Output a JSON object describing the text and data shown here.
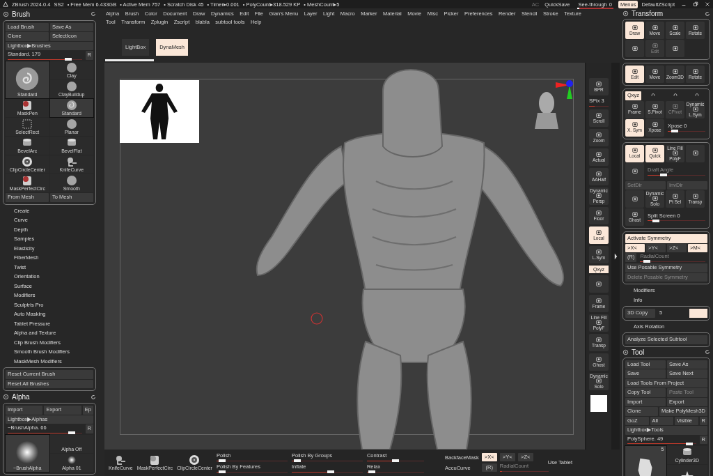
{
  "title_bar": {
    "app": "ZBrush 2024.0.4",
    "stats": [
      "SS2",
      "• Free Mem 6.433GB",
      "• Active Mem 757",
      "• Scratch Disk 45",
      "• Timer▸0.001",
      "• PolyCount▸318.529 KP",
      "• MeshCount▸5"
    ],
    "ac": "AC",
    "quicksave": "QuickSave",
    "see_through": {
      "label": "See-through",
      "value": "0",
      "level": 0
    },
    "menus": {
      "label": "Menus",
      "selected": true
    },
    "script": "DefaultZScript"
  },
  "menu_bar": [
    "Alpha",
    "Brush",
    "Color",
    "Document",
    "Draw",
    "Dynamics",
    "Edit",
    "File",
    "Gian's Menu",
    "Layer",
    "Light",
    "Macro",
    "Marker",
    "Material",
    "Movie",
    "Misc",
    "Picker",
    "Preferences",
    "Render",
    "Stencil",
    "Stroke",
    "Texture",
    "Tool",
    "Transform",
    "Zplugin",
    "Zscript",
    "blabla",
    "subtool tools",
    "Help"
  ],
  "doc_tabs": [
    {
      "label": "LightBox",
      "selected": false
    },
    {
      "label": "DynaMesh",
      "selected": true
    }
  ],
  "left_panel": [
    {
      "title": "Brush",
      "sections": [
        {
          "kind": "box",
          "parts": [
            {
              "kind": "row",
              "controls": [
                {
                  "kind": "button",
                  "label": "Load Brush"
                },
                {
                  "kind": "button",
                  "label": "Save As"
                }
              ]
            },
            {
              "kind": "row",
              "controls": [
                {
                  "kind": "button",
                  "label": "Clone"
                },
                {
                  "kind": "button",
                  "label": "SelectIcon"
                }
              ]
            },
            {
              "kind": "row",
              "controls": [
                {
                  "kind": "button",
                  "label": "Lightbox▶Brushes"
                }
              ]
            },
            {
              "kind": "row",
              "controls": [
                {
                  "kind": "slider",
                  "label": "Standard. 179",
                  "level": 0.85
                },
                {
                  "kind": "small",
                  "label": "R"
                }
              ]
            },
            {
              "kind": "tiles",
              "current": {
                "name": "Standard",
                "kind": "swirl"
              },
              "items": [
                {
                  "name": "Clay",
                  "kind": "sphere",
                  "selected": false
                },
                {
                  "name": "ClayBuildup",
                  "kind": "sphere",
                  "selected": false
                },
                {
                  "name": "MaskPen",
                  "kind": "mask",
                  "selected": false
                },
                {
                  "name": "Standard",
                  "kind": "swirl",
                  "selected": true
                },
                {
                  "name": "SelectRect",
                  "kind": "rect",
                  "selected": false
                },
                {
                  "name": "Planar",
                  "kind": "sphere",
                  "selected": false
                },
                {
                  "name": "BevelArc",
                  "kind": "cylinder",
                  "selected": false
                },
                {
                  "name": "BevelFlat",
                  "kind": "cylinder",
                  "selected": false
                },
                {
                  "name": "ClipCircleCenter",
                  "kind": "clip",
                  "selected": false
                },
                {
                  "name": "KnifeCurve",
                  "kind": "knife",
                  "selected": false
                },
                {
                  "name": "MaskPerfectCirc",
                  "kind": "mask",
                  "selected": false
                },
                {
                  "name": "Smooth",
                  "kind": "sphere",
                  "selected": false
                }
              ]
            },
            {
              "kind": "row",
              "controls": [
                {
                  "kind": "button",
                  "label": "From Mesh"
                },
                {
                  "kind": "button",
                  "label": "To Mesh"
                }
              ]
            }
          ]
        },
        {
          "kind": "item",
          "label": "Create"
        },
        {
          "kind": "item",
          "label": "Curve"
        },
        {
          "kind": "item",
          "label": "Depth"
        },
        {
          "kind": "item",
          "label": "Samples"
        },
        {
          "kind": "item",
          "label": "Elasticity"
        },
        {
          "kind": "item",
          "label": "FiberMesh"
        },
        {
          "kind": "item",
          "label": "Twist"
        },
        {
          "kind": "item",
          "label": "Orientation"
        },
        {
          "kind": "item",
          "label": "Surface"
        },
        {
          "kind": "item",
          "label": "Modifiers"
        },
        {
          "kind": "item",
          "label": "Sculptris Pro"
        },
        {
          "kind": "item",
          "label": "Auto Masking"
        },
        {
          "kind": "item",
          "label": "Tablet Pressure"
        },
        {
          "kind": "item",
          "label": "Alpha and Texture"
        },
        {
          "kind": "item",
          "label": "Clip Brush Modifiers"
        },
        {
          "kind": "item",
          "label": "Smooth Brush Modifiers"
        },
        {
          "kind": "item",
          "label": "MaskMesh Modifiers"
        },
        {
          "kind": "box",
          "parts": [
            {
              "kind": "row",
              "controls": [
                {
                  "kind": "button",
                  "label": "Reset Current Brush"
                }
              ]
            },
            {
              "kind": "row",
              "controls": [
                {
                  "kind": "button",
                  "label": "Reset All Brushes"
                }
              ]
            }
          ]
        }
      ]
    },
    {
      "title": "Alpha",
      "sections": [
        {
          "kind": "box",
          "parts": [
            {
              "kind": "row",
              "controls": [
                {
                  "kind": "button",
                  "label": "Import"
                },
                {
                  "kind": "button",
                  "label": "Export"
                },
                {
                  "kind": "small",
                  "label": "Ep"
                }
              ]
            },
            {
              "kind": "row",
              "controls": [
                {
                  "kind": "button",
                  "label": "Lightbox▶Alphas"
                }
              ]
            },
            {
              "kind": "row",
              "controls": [
                {
                  "kind": "slider",
                  "label": "~BrushAlpha. 66",
                  "level": 0.9
                },
                {
                  "kind": "small",
                  "label": "R"
                }
              ]
            },
            {
              "kind": "tiles",
              "current": {
                "name": "~BrushAlpha",
                "kind": "glow"
              },
              "items": [
                {
                  "name": "Alpha Off",
                  "kind": "none",
                  "selected": false
                },
                {
                  "name": "Alpha 01",
                  "kind": "glow",
                  "selected": false
                }
              ]
            }
          ]
        }
      ]
    }
  ],
  "right_panel": [
    {
      "title": "Transform",
      "sections": [
        {
          "kind": "box",
          "parts": [
            {
              "kind": "row",
              "controls": [
                {
                  "kind": "icon",
                  "label": "Draw",
                  "on": true
                },
                {
                  "kind": "icon",
                  "label": "Move",
                  "on": false
                },
                {
                  "kind": "icon",
                  "label": "Scale",
                  "on": false
                },
                {
                  "kind": "icon",
                  "label": "Rotate",
                  "on": false
                }
              ]
            },
            {
              "kind": "row",
              "controls": [
                {
                  "kind": "icon",
                  "disabled": false
                },
                {
                  "kind": "icon",
                  "label": "Edit",
                  "disabled": true
                },
                {
                  "kind": "icon",
                  "disabled": false
                }
              ]
            }
          ]
        },
        {
          "kind": "box",
          "parts": [
            {
              "kind": "row",
              "controls": [
                {
                  "kind": "icon",
                  "label": "Edit",
                  "on": true
                },
                {
                  "kind": "icon",
                  "label": "Move",
                  "on": false
                },
                {
                  "kind": "icon",
                  "label": "Zoom3D",
                  "on": false
                },
                {
                  "kind": "icon",
                  "label": "Rotate",
                  "on": false
                }
              ]
            }
          ]
        },
        {
          "kind": "box",
          "parts": [
            {
              "kind": "row",
              "controls": [
                {
                  "kind": "small",
                  "label": "Qxyz",
                  "on": true
                },
                {
                  "kind": "mini",
                  "on": false
                },
                {
                  "kind": "mini",
                  "on": false
                },
                {
                  "kind": "mini",
                  "on": false
                }
              ]
            },
            {
              "kind": "row",
              "controls": [
                {
                  "kind": "icon",
                  "label": "Frame",
                  "disabled": false
                },
                {
                  "kind": "icon",
                  "label": "S.Pivot",
                  "disabled": false
                },
                {
                  "kind": "icon",
                  "label": "CPivot",
                  "disabled": true
                },
                {
                  "kind": "icon",
                  "label": "L.Sym",
                  "caption": "Dynamic",
                  "disabled": false
                }
              ]
            },
            {
              "kind": "row",
              "controls": [
                {
                  "kind": "icon",
                  "label": "X. Sym",
                  "on": true
                },
                {
                  "kind": "icon",
                  "label": "Xpose",
                  "on": false
                },
                {
                  "kind": "slider",
                  "label": "Xpose 0",
                  "level": 0.12
                }
              ]
            }
          ]
        },
        {
          "kind": "box",
          "parts": [
            {
              "kind": "row",
              "controls": [
                {
                  "kind": "icon",
                  "label": "Local",
                  "on": true
                },
                {
                  "kind": "icon",
                  "label": "Quick",
                  "on": true
                },
                {
                  "kind": "icon",
                  "label": "PolyF",
                  "caption": "Line Fill",
                  "on": false
                },
                {
                  "kind": "icon",
                  "on": false
                }
              ]
            },
            {
              "kind": "row",
              "controls": [
                {
                  "kind": "icon",
                  "disabled": false
                },
                {
                  "kind": "slider",
                  "label": "Draft Angle",
                  "level": 0.25,
                  "disabled": true
                }
              ]
            },
            {
              "kind": "row",
              "controls": [
                {
                  "kind": "button",
                  "label": "SetDir",
                  "disabled": true
                },
                {
                  "kind": "button",
                  "label": "InvDir",
                  "disabled": true
                }
              ]
            },
            {
              "kind": "row",
              "controls": [
                {
                  "kind": "icon"
                },
                {
                  "kind": "icon",
                  "label": "Solo",
                  "caption": "Dynamic"
                },
                {
                  "kind": "icon",
                  "label": "Pt Sel"
                },
                {
                  "kind": "icon",
                  "label": "Transp"
                }
              ]
            },
            {
              "kind": "row",
              "controls": [
                {
                  "kind": "icon",
                  "label": "Ghost"
                },
                {
                  "kind": "slider",
                  "label": "Split Screen 0",
                  "level": 0.1
                }
              ]
            }
          ]
        },
        {
          "kind": "box",
          "parts": [
            {
              "kind": "row",
              "controls": [
                {
                  "kind": "button",
                  "label": "Activate Symmetry",
                  "on": true
                }
              ]
            },
            {
              "kind": "row",
              "controls": [
                {
                  "kind": "button",
                  "label": ">X<",
                  "on": true
                },
                {
                  "kind": "button",
                  "label": ">Y<",
                  "on": false
                },
                {
                  "kind": "button",
                  "label": ">Z<",
                  "on": false
                },
                {
                  "kind": "button",
                  "label": ">M<",
                  "on": true
                }
              ]
            },
            {
              "kind": "row",
              "controls": [
                {
                  "kind": "small",
                  "label": "(R)",
                  "disabled": false
                },
                {
                  "kind": "slider",
                  "label": "RadialCount",
                  "level": 0.05,
                  "disabled": true
                }
              ]
            },
            {
              "kind": "row",
              "controls": [
                {
                  "kind": "button",
                  "label": "Use Posable Symmetry",
                  "disabled": false
                }
              ]
            },
            {
              "kind": "row",
              "controls": [
                {
                  "kind": "button",
                  "label": "Delete Posable Symmetry",
                  "disabled": true
                }
              ]
            }
          ]
        },
        {
          "kind": "item",
          "label": "Modifiers"
        },
        {
          "kind": "item",
          "label": "Info"
        },
        {
          "kind": "box",
          "parts": [
            {
              "kind": "row",
              "controls": [
                {
                  "kind": "button",
                  "label": "3D Copy",
                  "on": false
                },
                {
                  "kind": "text",
                  "label": "5"
                },
                {
                  "kind": "field",
                  "on": true
                }
              ]
            }
          ]
        },
        {
          "kind": "item",
          "label": "Axis Rotation"
        },
        {
          "kind": "box",
          "parts": [
            {
              "kind": "row",
              "controls": [
                {
                  "kind": "button",
                  "label": "Analyze Selected Subtool"
                }
              ]
            }
          ]
        }
      ]
    },
    {
      "title": "Tool",
      "sections": [
        {
          "kind": "box",
          "parts": [
            {
              "kind": "row",
              "controls": [
                {
                  "kind": "button",
                  "label": "Load Tool"
                },
                {
                  "kind": "button",
                  "label": "Save As"
                }
              ]
            },
            {
              "kind": "row",
              "controls": [
                {
                  "kind": "button",
                  "label": "Save"
                },
                {
                  "kind": "button",
                  "label": "Save Next"
                }
              ]
            },
            {
              "kind": "row",
              "controls": [
                {
                  "kind": "button",
                  "label": "Load Tools From Project"
                }
              ]
            },
            {
              "kind": "row",
              "controls": [
                {
                  "kind": "button",
                  "label": "Copy Tool",
                  "disabled": false
                },
                {
                  "kind": "button",
                  "label": "Paste Tool",
                  "disabled": true
                }
              ]
            },
            {
              "kind": "row",
              "controls": [
                {
                  "kind": "button",
                  "label": "Import"
                },
                {
                  "kind": "button",
                  "label": "Export"
                }
              ]
            },
            {
              "kind": "row",
              "controls": [
                {
                  "kind": "button",
                  "label": "Clone"
                },
                {
                  "kind": "button",
                  "label": "Make PolyMesh3D"
                }
              ]
            },
            {
              "kind": "row",
              "controls": [
                {
                  "kind": "button",
                  "label": "GoZ"
                },
                {
                  "kind": "button",
                  "label": "All"
                },
                {
                  "kind": "button",
                  "label": "Visible"
                },
                {
                  "kind": "small",
                  "label": "R"
                }
              ]
            },
            {
              "kind": "row",
              "controls": [
                {
                  "kind": "button",
                  "label": "Lightbox▶Tools"
                }
              ]
            },
            {
              "kind": "row",
              "controls": [
                {
                  "kind": "slider",
                  "label": "PolySphere. 49",
                  "level": 0.95
                },
                {
                  "kind": "small",
                  "label": "R"
                }
              ]
            },
            {
              "kind": "tiles",
              "current": {
                "kind": "rock",
                "badge": "5"
              },
              "items": [
                {
                  "name": "Cylinder3D",
                  "kind": "cylinder",
                  "selected": false
                },
                {
                  "kind": "star",
                  "selected": false
                }
              ]
            }
          ]
        }
      ]
    }
  ],
  "right_shelf": [
    {
      "kind": "icon",
      "label": "BPR",
      "on": false
    },
    {
      "kind": "slider",
      "label": "SPix 3",
      "level": 0.3
    },
    {
      "kind": "icon",
      "label": "Scroll",
      "on": false
    },
    {
      "kind": "icon",
      "label": "Zoom",
      "on": false
    },
    {
      "kind": "icon",
      "label": "Actual",
      "on": false
    },
    {
      "kind": "icon",
      "label": "AAHalf",
      "on": false
    },
    {
      "kind": "icon",
      "label": "Persp",
      "caption": "Dynamic",
      "on": false
    },
    {
      "kind": "icon",
      "label": "Floor",
      "on": false
    },
    {
      "kind": "icon",
      "label": "Local",
      "on": true
    },
    {
      "kind": "icon",
      "label": "L.Sym",
      "on": false
    },
    {
      "kind": "small",
      "label": "Qxyz",
      "on": true
    },
    {
      "kind": "icon",
      "on": false
    },
    {
      "kind": "icon",
      "label": "Frame",
      "on": false
    },
    {
      "kind": "icon",
      "label": "PolyF",
      "caption": "Line Fill",
      "on": false
    },
    {
      "kind": "icon",
      "label": "Transp",
      "on": false
    },
    {
      "kind": "icon",
      "label": "Ghost",
      "on": false
    },
    {
      "kind": "icon",
      "label": "Solo",
      "caption": "Dynamic",
      "on": false
    },
    {
      "kind": "swatch"
    }
  ],
  "bottom_shelf": {
    "brushes": [
      {
        "name": "KnifeCurve",
        "kind": "knife"
      },
      {
        "name": "MaskPerfectCirc",
        "kind": "mask"
      },
      {
        "name": "ClipCircleCenter",
        "kind": "clip"
      }
    ],
    "sliders": [
      {
        "label": "Polish",
        "level": 0.03
      },
      {
        "label": "Polish By Groups",
        "level": 0.03
      },
      {
        "label": "Contrast",
        "level": 0.5
      },
      {
        "label": "Polish By Features",
        "level": 0.03
      },
      {
        "label": "Inflate",
        "level": 0.55
      },
      {
        "label": "Relax",
        "level": 0.03
      }
    ],
    "mask_label": "BackfaceMask",
    "axes": [
      {
        "label": ">X<",
        "selected": true
      },
      {
        "label": ">Y<",
        "selected": false
      },
      {
        "label": ">Z<",
        "selected": false
      }
    ],
    "accucurve": "AccuCurve",
    "radial_button": "(R)",
    "radial": {
      "label": "RadialCount",
      "level": 0.05
    },
    "tablet": "Use Tablet"
  }
}
